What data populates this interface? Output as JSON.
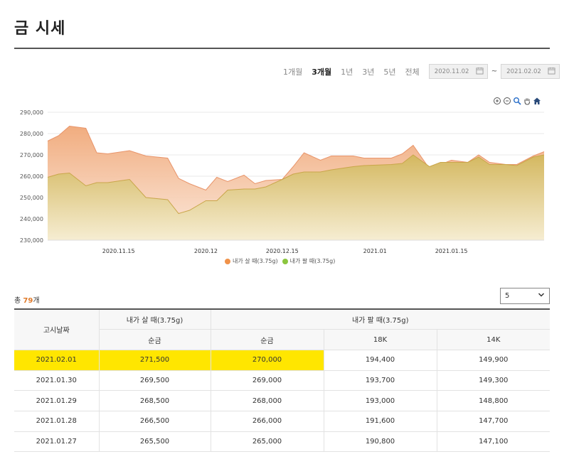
{
  "page": {
    "title": "금 시세"
  },
  "period": {
    "tabs": [
      {
        "label": "1개월",
        "active": false
      },
      {
        "label": "3개월",
        "active": true
      },
      {
        "label": "1년",
        "active": false
      },
      {
        "label": "3년",
        "active": false
      },
      {
        "label": "5년",
        "active": false
      },
      {
        "label": "전체",
        "active": false
      }
    ],
    "start_date": "2020.11.02",
    "separator": "~",
    "end_date": "2021.02.02"
  },
  "chart_tools": [
    "zoom-in-icon",
    "zoom-out-icon",
    "magnify-icon",
    "pan-icon",
    "home-icon"
  ],
  "chart_data": {
    "type": "area",
    "title": "",
    "xlabel": "",
    "ylabel": "",
    "ylim": [
      230000,
      290000
    ],
    "y_ticks": [
      "230,000",
      "240,000",
      "250,000",
      "260,000",
      "270,000",
      "280,000",
      "290,000"
    ],
    "x_ticks": [
      "2020.11.15",
      "2020.12",
      "2020.12.15",
      "2021.01",
      "2021.01.15"
    ],
    "x": [
      "2020.11.02",
      "2020.11.04",
      "2020.11.06",
      "2020.11.09",
      "2020.11.11",
      "2020.11.13",
      "2020.11.17",
      "2020.11.20",
      "2020.11.24",
      "2020.11.26",
      "2020.11.28",
      "2020.12.01",
      "2020.12.03",
      "2020.12.05",
      "2020.12.08",
      "2020.12.10",
      "2020.12.12",
      "2020.12.15",
      "2020.12.17",
      "2020.12.19",
      "2020.12.22",
      "2020.12.24",
      "2020.12.28",
      "2020.12.30",
      "2021.01.04",
      "2021.01.06",
      "2021.01.08",
      "2021.01.11",
      "2021.01.13",
      "2021.01.15",
      "2021.01.18",
      "2021.01.20",
      "2021.01.22",
      "2021.01.25",
      "2021.01.27",
      "2021.01.30",
      "2021.02.01"
    ],
    "series": [
      {
        "name": "내가 살 때(3.75g)",
        "color": "#f0a878",
        "values": [
          276500,
          279000,
          283500,
          282500,
          271000,
          270500,
          272000,
          269500,
          268500,
          259000,
          256500,
          253500,
          259500,
          257500,
          260500,
          256500,
          258000,
          258500,
          264500,
          271000,
          267500,
          269500,
          269500,
          268500,
          268500,
          270500,
          274500,
          263500,
          265500,
          267500,
          266500,
          270000,
          266500,
          265500,
          265500,
          269500,
          271500
        ]
      },
      {
        "name": "내가 팔 때(3.75g)",
        "color": "#d4b860",
        "values": [
          259500,
          261000,
          261500,
          255500,
          257000,
          257000,
          258500,
          250000,
          249000,
          242500,
          244000,
          248500,
          248500,
          253500,
          254000,
          254000,
          255000,
          258500,
          261000,
          262000,
          262000,
          263000,
          264500,
          265000,
          265500,
          266000,
          270000,
          264500,
          266500,
          266500,
          266500,
          269000,
          265500,
          265500,
          265000,
          269000,
          270000
        ]
      }
    ]
  },
  "legend": [
    {
      "label": "내가 살 때(3.75g)",
      "color": "#f0924a"
    },
    {
      "label": "내가 팔 때(3.75g)",
      "color": "#8cc63f"
    }
  ],
  "summary": {
    "prefix": "총 ",
    "count": "79",
    "suffix": "개"
  },
  "page_size": {
    "value": "5"
  },
  "table": {
    "header": {
      "date": "고시날짜",
      "buy_group": "내가 살 때(3.75g)",
      "sell_group": "내가 팔 때(3.75g)",
      "buy_pure": "순금",
      "sell_pure": "순금",
      "sell_18k": "18K",
      "sell_14k": "14K"
    },
    "rows": [
      {
        "date": "2021.02.01",
        "buy": "271,500",
        "sell": "270,000",
        "k18": "194,400",
        "k14": "149,900",
        "highlight": true
      },
      {
        "date": "2021.01.30",
        "buy": "269,500",
        "sell": "269,000",
        "k18": "193,700",
        "k14": "149,300"
      },
      {
        "date": "2021.01.29",
        "buy": "268,500",
        "sell": "268,000",
        "k18": "193,000",
        "k14": "148,800"
      },
      {
        "date": "2021.01.28",
        "buy": "266,500",
        "sell": "266,000",
        "k18": "191,600",
        "k14": "147,700"
      },
      {
        "date": "2021.01.27",
        "buy": "265,500",
        "sell": "265,000",
        "k18": "190,800",
        "k14": "147,100"
      }
    ]
  }
}
